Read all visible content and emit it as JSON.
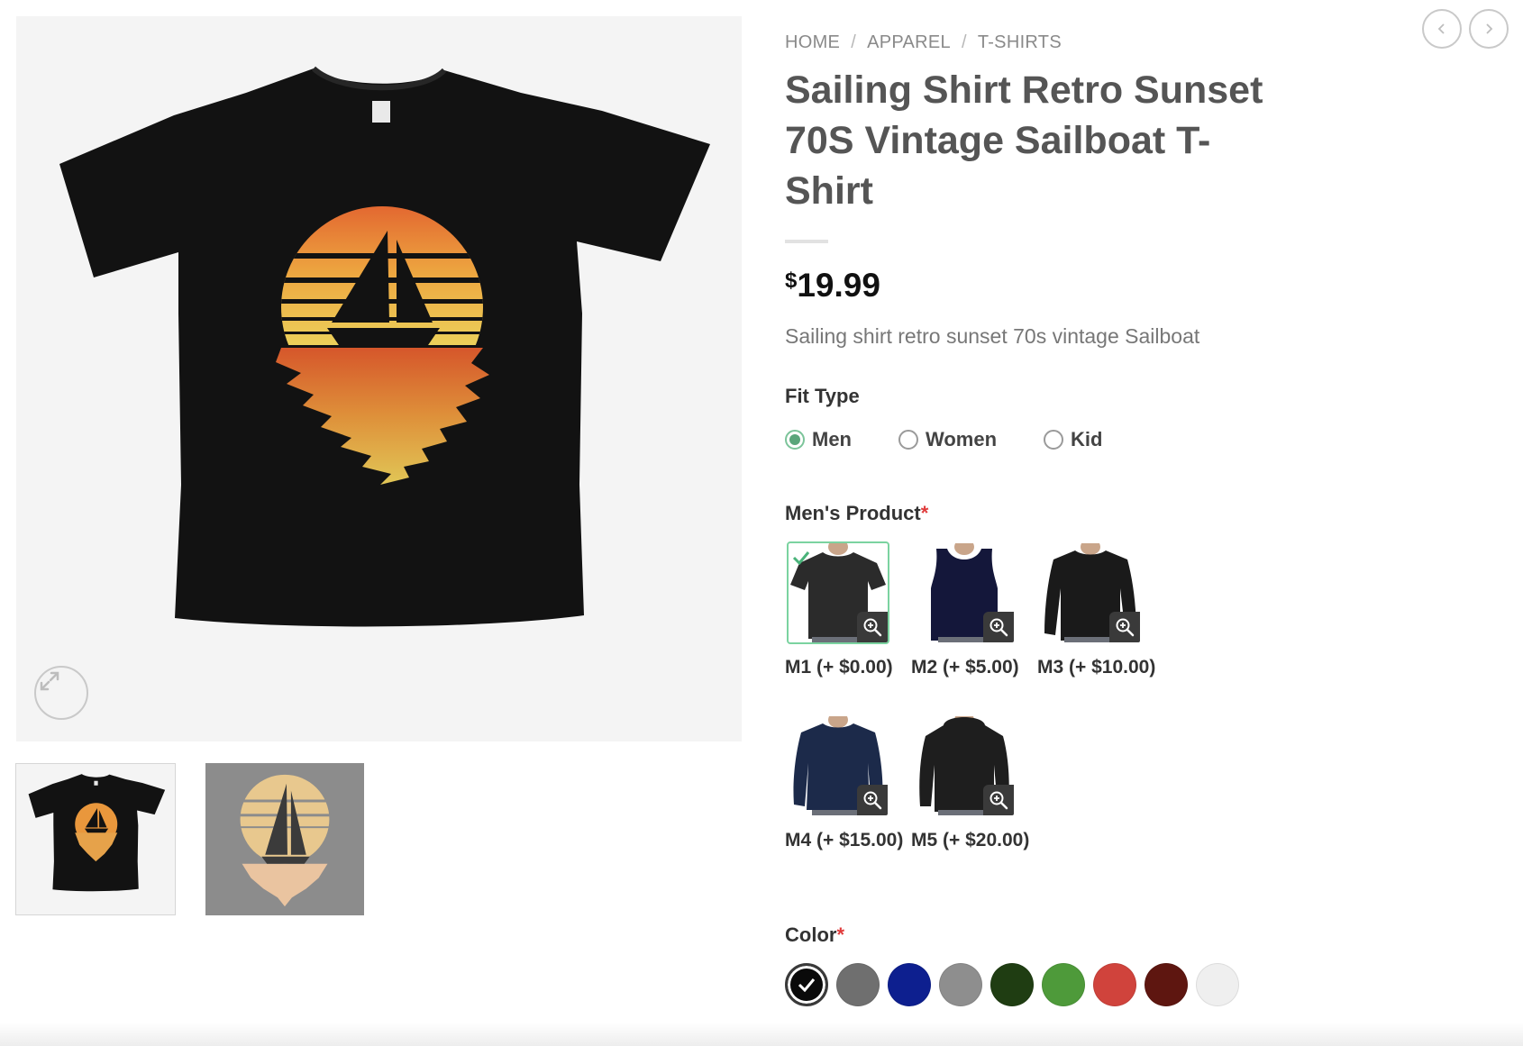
{
  "breadcrumb": [
    {
      "label": "HOME"
    },
    {
      "label": "APPAREL"
    },
    {
      "label": "T-SHIRTS"
    }
  ],
  "breadcrumb_separator": "/",
  "product": {
    "title": "Sailing Shirt Retro Sunset 70S Vintage Sailboat T-Shirt",
    "currency_symbol": "$",
    "price": "19.99",
    "short_description": "Sailing shirt retro sunset 70s vintage Sailboat"
  },
  "fit_type": {
    "label": "Fit Type",
    "options": [
      "Men",
      "Women",
      "Kid"
    ],
    "selected": "Men"
  },
  "mens_product": {
    "label": "Men's Product",
    "required_mark": "*",
    "selected": "M1",
    "options": [
      {
        "code": "M1",
        "label": "M1 (+ $0.00)",
        "style": "tee",
        "color": "#2b2b2b"
      },
      {
        "code": "M2",
        "label": "M2 (+ $5.00)",
        "style": "tank",
        "color": "#14173a"
      },
      {
        "code": "M3",
        "label": "M3 (+ $10.00)",
        "style": "longsleeve",
        "color": "#1a1a1a"
      },
      {
        "code": "M4",
        "label": "M4 (+ $15.00)",
        "style": "sweatshirt",
        "color": "#1c2a4a"
      },
      {
        "code": "M5",
        "label": "M5 (+ $20.00)",
        "style": "hoodie",
        "color": "#1e1e1e"
      }
    ]
  },
  "color": {
    "label": "Color",
    "required_mark": "*",
    "selected_index": 0,
    "swatches": [
      "#0a0a0a",
      "#6f6f6f",
      "#0d1f8f",
      "#8e8e8e",
      "#1f3d12",
      "#4e9a3a",
      "#d0433c",
      "#5e1610",
      "#efefef"
    ]
  },
  "gallery": {
    "active_index": 0,
    "icons": {
      "expand": "expand-icon",
      "prev": "chevron-left-icon",
      "next": "chevron-right-icon",
      "zoom": "zoom-in-icon",
      "check": "check-icon"
    }
  }
}
